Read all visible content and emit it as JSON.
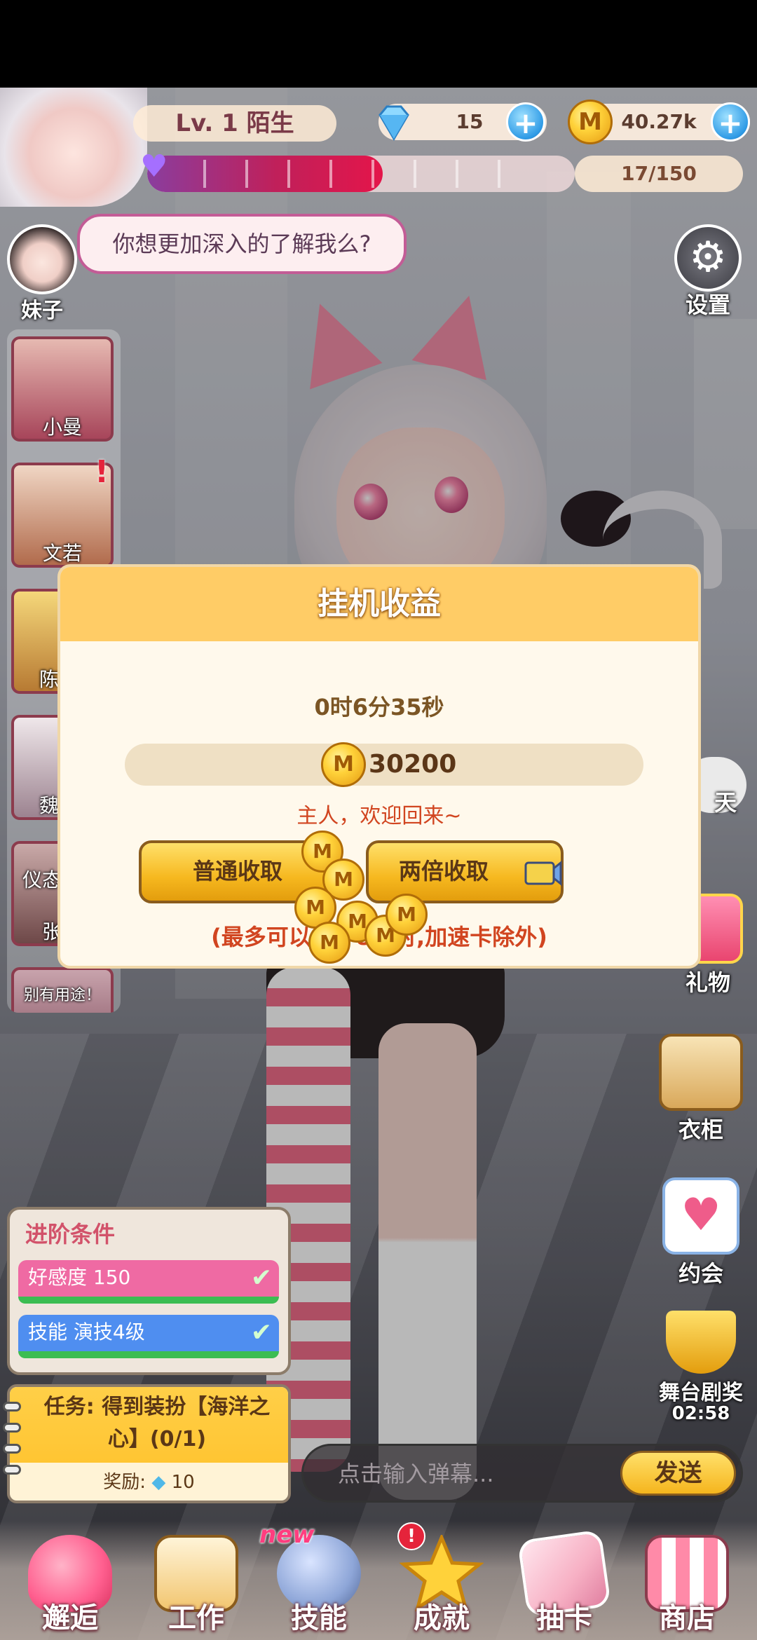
{
  "top": {
    "level": "Lv. 1",
    "name": "陌生",
    "gems": "15",
    "coins": "40.27k",
    "affection": "17/150",
    "affection_fraction": 0.55,
    "plus": "+"
  },
  "bubble": "你想更加深入的了解我么?",
  "settings_label": "设置",
  "char_header_label": "妹子",
  "characters": [
    {
      "name": "小曼"
    },
    {
      "name": "文若"
    },
    {
      "name": "陈"
    },
    {
      "name": "魏"
    },
    {
      "name": "仪态"
    },
    {
      "name": "别有用途！"
    }
  ],
  "char_alert_mark": "!",
  "char_card_fragment": "张",
  "right_buttons": {
    "chat": "天",
    "gift": "礼物",
    "wardrobe": "衣柜",
    "date": "约会",
    "award": "舞台剧奖",
    "award_timer": "02:58"
  },
  "modal": {
    "title": "挂机收益",
    "time": "0时6分35秒",
    "amount": "30200",
    "welcome": "主人，欢迎回来~",
    "collect_normal": "普通收取",
    "collect_double": "两倍收取",
    "note": "(最多可以累计8小时,加速卡除外)"
  },
  "advancement": {
    "title": "进阶条件",
    "rows": [
      {
        "label": "好感度 150",
        "color": "#ef6aa3"
      },
      {
        "label": "技能 演技4级",
        "color": "#4f8ef0"
      }
    ],
    "check": "✔"
  },
  "task": {
    "text": "任务: 得到装扮【海洋之心】(0/1)",
    "reward_label": "奖励:",
    "reward_value": "10"
  },
  "chat": {
    "placeholder": "点击输入弹幕...",
    "send": "发送"
  },
  "nav": [
    {
      "label": "邂逅",
      "icon": "hearts-icon",
      "color": "#ff5f8f"
    },
    {
      "label": "工作",
      "icon": "notebook-icon",
      "color": "#f2c670"
    },
    {
      "label": "技能",
      "icon": "microphone-icon",
      "color": "#8ea6d8",
      "tag": "new"
    },
    {
      "label": "成就",
      "icon": "star-icon",
      "color": "#ffd23a",
      "badge": "!"
    },
    {
      "label": "抽卡",
      "icon": "cards-icon",
      "color": "#f7b0c4"
    },
    {
      "label": "商店",
      "icon": "shop-icon",
      "color": "#ff8aa8"
    }
  ],
  "colors": {
    "accent_gold": "#ffcc66",
    "modal_bg": "#fff9ec",
    "warning_red": "#d14520"
  }
}
